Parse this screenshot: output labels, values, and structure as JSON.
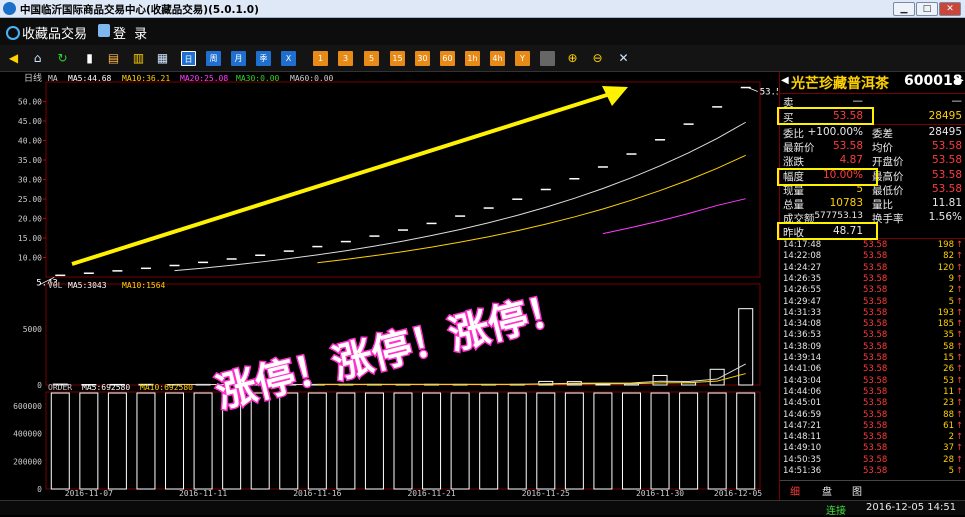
{
  "window": {
    "title": "中国临沂国际商品交易中心(收藏品交易)(5.0.1.0)"
  },
  "menu": {
    "logo": "收藏品交易",
    "login": "登 录"
  },
  "toolbar": {
    "period_buttons": [
      "日",
      "周",
      "月",
      "季",
      "X"
    ],
    "number_buttons": [
      "1",
      "3",
      "5",
      "15",
      "30",
      "60",
      "1h",
      "4h",
      "Y"
    ]
  },
  "chart": {
    "period_label": "日线",
    "ma_label": "MA",
    "ma5": "MA5:44.68",
    "ma10": "MA10:36.21",
    "ma20": "MA20:25.08",
    "ma30": "MA30:0.00",
    "ma60": "MA60:0.00",
    "y_ticks": [
      "50.00",
      "45.00",
      "40.00",
      "35.00",
      "30.00",
      "25.00",
      "20.00",
      "15.00",
      "10.00"
    ],
    "high_label": "53.58",
    "low_label": "5.43",
    "vol_label": "VOL",
    "vol_ma5": "MA5:3043",
    "vol_ma10": "MA10:1564",
    "vol_ticks": [
      "5000",
      "0"
    ],
    "order_label": "ORDER",
    "order_ma5": "MA5:692580",
    "order_ma10": "MA10:692580",
    "order_ticks": [
      "600000",
      "400000",
      "200000",
      "0"
    ],
    "dates": [
      "2016-11-07",
      "2016-11-11",
      "2016-11-16",
      "2016-11-21",
      "2016-11-25",
      "2016-11-30",
      "2016-12-05"
    ],
    "overlay_text": "涨停！涨停！涨停！"
  },
  "chart_data": {
    "type": "bar",
    "title": "",
    "categories": [
      "2016-11-07",
      "2016-11-11",
      "2016-11-16",
      "2016-11-21",
      "2016-11-25",
      "2016-11-30",
      "2016-12-05"
    ],
    "close_series": {
      "name": "close",
      "values": [
        5.43,
        5.97,
        6.57,
        7.23,
        7.95,
        8.75,
        9.62,
        10.58,
        11.64,
        12.8,
        14.08,
        15.49,
        17.04,
        18.74,
        20.62,
        22.68,
        24.95,
        27.44,
        30.19,
        33.21,
        36.53,
        40.18,
        44.2,
        48.62,
        53.58
      ]
    },
    "ma5": [
      null,
      null,
      null,
      null,
      6.63,
      7.29,
      8.02,
      8.83,
      9.71,
      10.68,
      11.74,
      12.92,
      14.21,
      15.63,
      17.19,
      18.91,
      20.8,
      22.88,
      25.17,
      27.69,
      30.46,
      33.5,
      36.85,
      40.54,
      44.68
    ],
    "ma10": [
      null,
      null,
      null,
      null,
      null,
      null,
      null,
      null,
      null,
      8.66,
      9.52,
      10.47,
      11.52,
      12.67,
      13.94,
      15.33,
      16.86,
      18.55,
      20.4,
      22.44,
      24.69,
      27.16,
      29.87,
      32.86,
      36.21
    ],
    "ma20": [
      null,
      null,
      null,
      null,
      null,
      null,
      null,
      null,
      null,
      null,
      null,
      null,
      null,
      null,
      null,
      null,
      null,
      null,
      null,
      16.13,
      17.69,
      19.4,
      21.28,
      23.35,
      25.08
    ],
    "volume": {
      "values": [
        80,
        40,
        50,
        60,
        40,
        55,
        45,
        60,
        50,
        45,
        60,
        55,
        50,
        60,
        55,
        50,
        60,
        320,
        300,
        80,
        120,
        850,
        200,
        1400,
        6800
      ]
    },
    "order": {
      "values": [
        692580,
        692580,
        692580,
        692580,
        692580,
        692580,
        692580,
        692580,
        692580,
        692580,
        692580,
        692580,
        692580,
        692580,
        692580,
        692580,
        692580,
        692580,
        692580,
        692580,
        692580,
        692580,
        692580,
        692580,
        692580
      ]
    },
    "ylim": [
      5,
      55
    ],
    "vol_ylim": [
      0,
      9000
    ],
    "order_ylim": [
      0,
      700000
    ]
  },
  "quote": {
    "name": "光芒珍藏普洱茶",
    "code": "600018",
    "sell_label": "卖",
    "sell_price": "—",
    "sell_vol": "—",
    "buy_label": "买",
    "buy_price": "53.58",
    "buy_vol": "28495",
    "rows": [
      [
        "委比",
        "+100.00%",
        "委差",
        "28495"
      ],
      [
        "最新价",
        "53.58",
        "均价",
        "53.58"
      ],
      [
        "涨跌",
        "4.87",
        "开盘价",
        "53.58"
      ],
      [
        "幅度",
        "10.00%",
        "最高价",
        "53.58"
      ],
      [
        "现量",
        "5",
        "最低价",
        "53.58"
      ],
      [
        "总量",
        "10783",
        "量比",
        "11.81"
      ],
      [
        "成交额",
        "577753.13",
        "换手率",
        "1.56%"
      ],
      [
        "昨收",
        "48.71",
        "",
        ""
      ]
    ]
  },
  "ticks": [
    [
      "14:17:48",
      "53.58",
      "198",
      "↑"
    ],
    [
      "14:22:08",
      "53.58",
      "82",
      "↑"
    ],
    [
      "14:24:27",
      "53.58",
      "120",
      "↑"
    ],
    [
      "14:26:35",
      "53.58",
      "9",
      "↑"
    ],
    [
      "14:26:55",
      "53.58",
      "2",
      "↑"
    ],
    [
      "14:29:47",
      "53.58",
      "5",
      "↑"
    ],
    [
      "14:31:33",
      "53.58",
      "193",
      "↑"
    ],
    [
      "14:34:08",
      "53.58",
      "185",
      "↑"
    ],
    [
      "14:36:53",
      "53.58",
      "35",
      "↑"
    ],
    [
      "14:38:09",
      "53.58",
      "58",
      "↑"
    ],
    [
      "14:39:14",
      "53.58",
      "15",
      "↑"
    ],
    [
      "14:41:06",
      "53.58",
      "26",
      "↑"
    ],
    [
      "14:43:04",
      "53.58",
      "53",
      "↑"
    ],
    [
      "14:44:06",
      "53.58",
      "11",
      "↑"
    ],
    [
      "14:45:01",
      "53.58",
      "23",
      "↑"
    ],
    [
      "14:46:59",
      "53.58",
      "88",
      "↑"
    ],
    [
      "14:47:21",
      "53.58",
      "61",
      "↑"
    ],
    [
      "14:48:11",
      "53.58",
      "2",
      "↑"
    ],
    [
      "14:49:10",
      "53.58",
      "37",
      "↑"
    ],
    [
      "14:50:35",
      "53.58",
      "28",
      "↑"
    ],
    [
      "14:51:36",
      "53.58",
      "5",
      "↑"
    ]
  ],
  "side_tabs": [
    "细",
    "盘",
    "图"
  ],
  "status": {
    "connection": "连接",
    "datetime": "2016-12-05 14:51"
  },
  "colors": {
    "up": "#ff3c3c",
    "ma5": "#ffffff",
    "ma10": "#ffd200",
    "ma20": "#ff3cff",
    "arrow": "#fff200",
    "overlay": "#ff33cc"
  }
}
